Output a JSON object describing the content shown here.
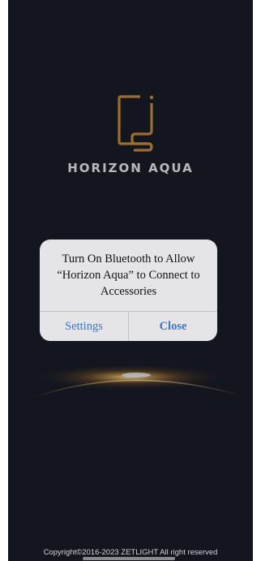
{
  "app": {
    "brand_name": "HORIZON AQUA",
    "logo_icon": "horizon-aqua-logo",
    "accent_color": "#d69a3c",
    "background_color": "#1c1f2b"
  },
  "alert": {
    "title": "Turn On Bluetooth to Allow “Horizon Aqua” to Connect to Accessories",
    "settings_label": "Settings",
    "close_label": "Close",
    "button_color": "#3478d6"
  },
  "footer": {
    "copyright": "Copyright©2016-2023 ZETLIGHT All right reserved"
  }
}
